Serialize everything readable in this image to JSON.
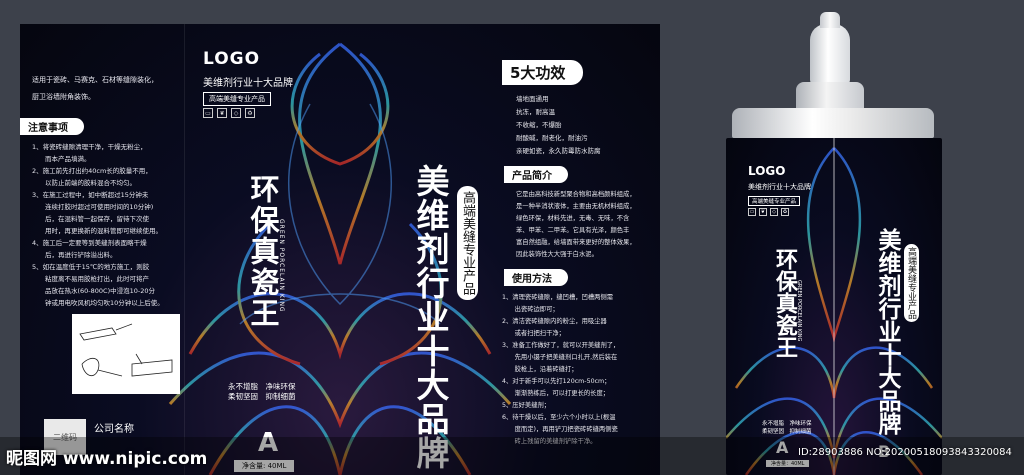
{
  "left_panel": {
    "intro": [
      "适用于瓷砖、马赛克、石材等缝隙装化，",
      "厨卫浴墙附角装饰。"
    ],
    "notes_title": "注意事项",
    "notes": [
      "1、将瓷砖缝隙清理干净，干燥无粉尘，",
      "　　而本产品填满。",
      "2、施工前先打出约40cm长的胶量不用，",
      "　　以防止前端的胶料混合不均匀。",
      "3、在施工过程中，如中断超过15分钟未",
      "　　连续打胶时超过可使用时间的10分钟)",
      "　　后，在混料管一起保存，留待下次使",
      "　　用时，再更换新的混料管即可继续使用。",
      "4、施工后一定要等到美缝剂表面略干燥",
      "　　后，再进行铲除溢出料。",
      "5、如在温度低于15℃的地方施工，则胶",
      "　　粘度离不易用胶枪打出，此时可将产",
      "　　品放在热水(60-800C)中浸泡10-20分",
      "　　钟或用电吹风机均匀吹10分钟以上后使。"
    ],
    "qr_label": "二维码",
    "company": "公司名称"
  },
  "center_panel": {
    "logo": "LOGO",
    "slogan": "美维剂行业十大品牌",
    "badge": "高端美缝专业产品",
    "product_name": "环保真瓷王",
    "english_name": "GREEN PORCELAIN KING",
    "tags": [
      "永不增脂　净味环保",
      "柔韧坚固　抑制细菌"
    ],
    "letter": "A",
    "net_content": "净含量: 40ML"
  },
  "brand_panel": {
    "brand_text": "美维剂行业十大品牌",
    "sub_pill": "高端美缝专业产品"
  },
  "right_panel": {
    "effects_title": "5大功效",
    "effects": [
      "墙地面通用",
      "抗冻，耐高温",
      "不收缩，不爆胎",
      "耐酸碱，耐老化，耐油污",
      "亲硬如瓷，永久防霉防水防腐"
    ],
    "intro_title": "产品简介",
    "intro": [
      "它是由高科技新型聚合物和高档颜料组成，",
      "是一种半消状液体，主要由无机材料组成，",
      "绿色环保，材料先进，无毒、无味，不含",
      "苯、甲苯、二甲苯。它具有光泽，颜色丰",
      "富自然组融，给墙面带来更好的整体效果，",
      "因此装饰性大大强于白水泥。"
    ],
    "usage_title": "使用方法",
    "usage": [
      "1、清理瓷砖缝隙，缝凹槽，凹槽两侧需",
      "　　出瓷砖边即可；",
      "2、清洁瓷砖缝隙内的粉尘，用吸尘器",
      "　　或者扫把扫干净；",
      "3、准备工作做好了，就可以开美缝剂了，",
      "　　先用小镊子把美缝剂口扎开,然后装在",
      "　　胶枪上，沿着砖缝打；",
      "4、对于新手可以先打120cm-50cm；",
      "　　渐渐熟练后，可以打更长的长度；",
      "5、压好美缝剂；",
      "6、待干燥以后，至少六个小时以上(根温",
      "　　度而定)，再用铲刀把瓷砖砖缝两侧瓷",
      "　　砖上残留的美缝剂铲除干净。"
    ]
  },
  "bottle": {
    "logo": "LOGO",
    "slogan": "美维剂行业十大品牌",
    "badge": "高端美缝专业产品",
    "product_name": "环保真瓷王",
    "english_name": "GREEN PORCELAIN KING",
    "brand_text": "美维剂行业十大品牌",
    "sub_pill": "高端美缝专业产品",
    "tags": [
      "永不增脂　净味环保",
      "柔韧坚固　抑制细菌"
    ],
    "letter_a": "A",
    "net_content": "净含量：40ML",
    "letter_b": "B"
  },
  "watermark": {
    "left": "昵图网 www.nipic.com",
    "right": "ID:28903886 NO:20200518093843320084"
  }
}
